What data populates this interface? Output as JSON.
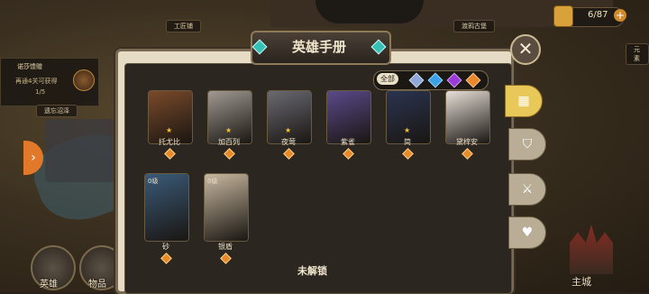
{
  "map": {
    "labels": [
      "工匠铺",
      "渡鸦古堡",
      "元素"
    ],
    "town_label": "遗忘沼泽"
  },
  "quest": {
    "title": "诺莎馈赠",
    "desc": "再通4关可获得",
    "progress": "1/5"
  },
  "resource": {
    "value": "6/87",
    "plus": "+"
  },
  "bottom_nav": {
    "heroes": "英雄",
    "items": "物品",
    "main_city": "主城"
  },
  "modal": {
    "title": "英雄手册",
    "close": "✕",
    "filters": {
      "all": "全部",
      "gems": [
        "#8ea8d8",
        "#3aa0e8",
        "#9a3ad8",
        "#e8882a"
      ]
    },
    "heroes_row1": [
      {
        "name": "托尤比",
        "stars": "★",
        "art": "#7a4a2a"
      },
      {
        "name": "加百列",
        "stars": "★",
        "art": "#a09a92"
      },
      {
        "name": "夜莺",
        "stars": "★",
        "art": "#6a6a72"
      },
      {
        "name": "紫雀",
        "stars": "",
        "art": "#5a4a8a"
      },
      {
        "name": "简",
        "stars": "★",
        "art": "#2a3450"
      },
      {
        "name": "黛梓安",
        "stars": "",
        "art": "#e8e0d8"
      }
    ],
    "heroes_row2": [
      {
        "name": "砂",
        "level": "0级",
        "art": "#3a5a78"
      },
      {
        "name": "银盾",
        "level": "0级",
        "art": "#c8b8a0"
      }
    ],
    "bottom_text": "未解锁"
  },
  "side_tabs": [
    "all",
    "shield",
    "sword",
    "heart"
  ]
}
